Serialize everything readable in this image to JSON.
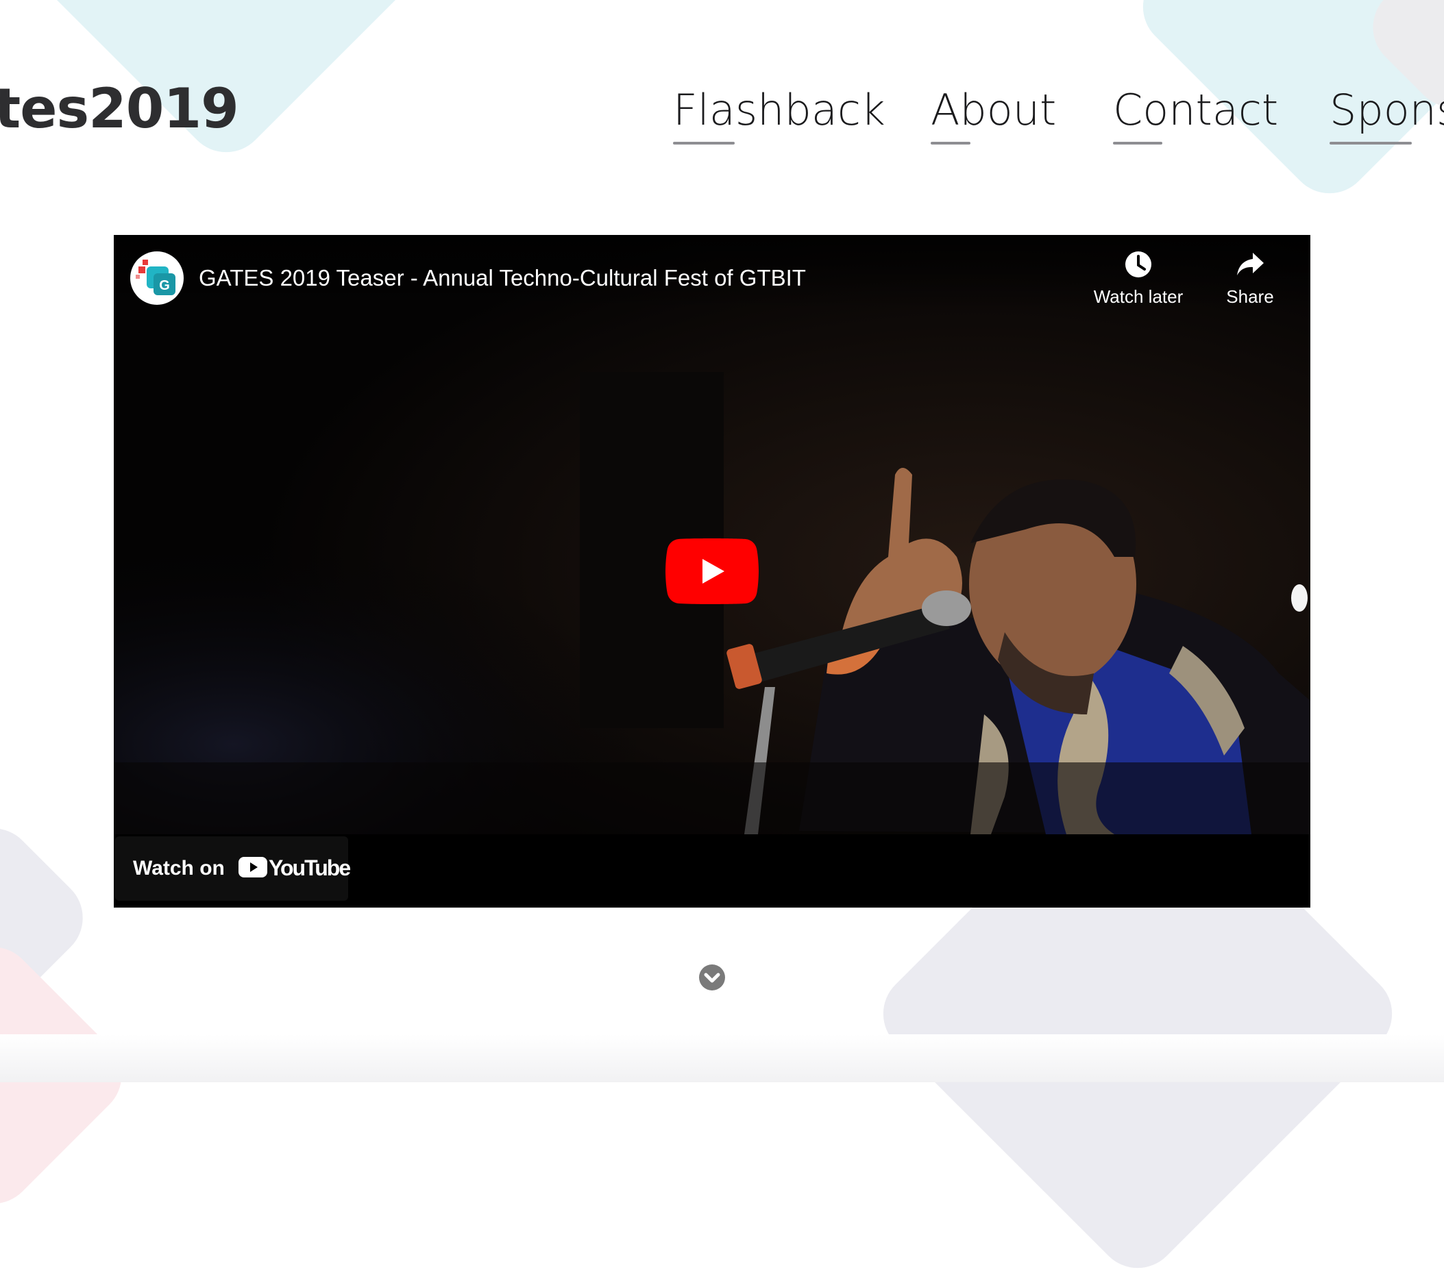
{
  "header": {
    "brand": "tes2019",
    "nav": [
      {
        "label": "Flashback"
      },
      {
        "label": "About"
      },
      {
        "label": "Contact"
      },
      {
        "label": "Spons"
      }
    ]
  },
  "video": {
    "title": "GATES 2019 Teaser - Annual Techno-Cultural Fest of GTBIT",
    "channel_avatar_letter": "G",
    "watch_later_label": "Watch later",
    "share_label": "Share",
    "watch_on_label": "Watch on",
    "youtube_wordmark": "YouTube"
  },
  "colors": {
    "youtube_red": "#ff0000",
    "nav_underline": "#8e8e92",
    "brand_text": "#2e2e30",
    "avatar_teal": "#21b4c4"
  },
  "icons": [
    "clock-icon",
    "share-arrow-icon",
    "youtube-play-icon",
    "chevron-down-circle-icon"
  ]
}
